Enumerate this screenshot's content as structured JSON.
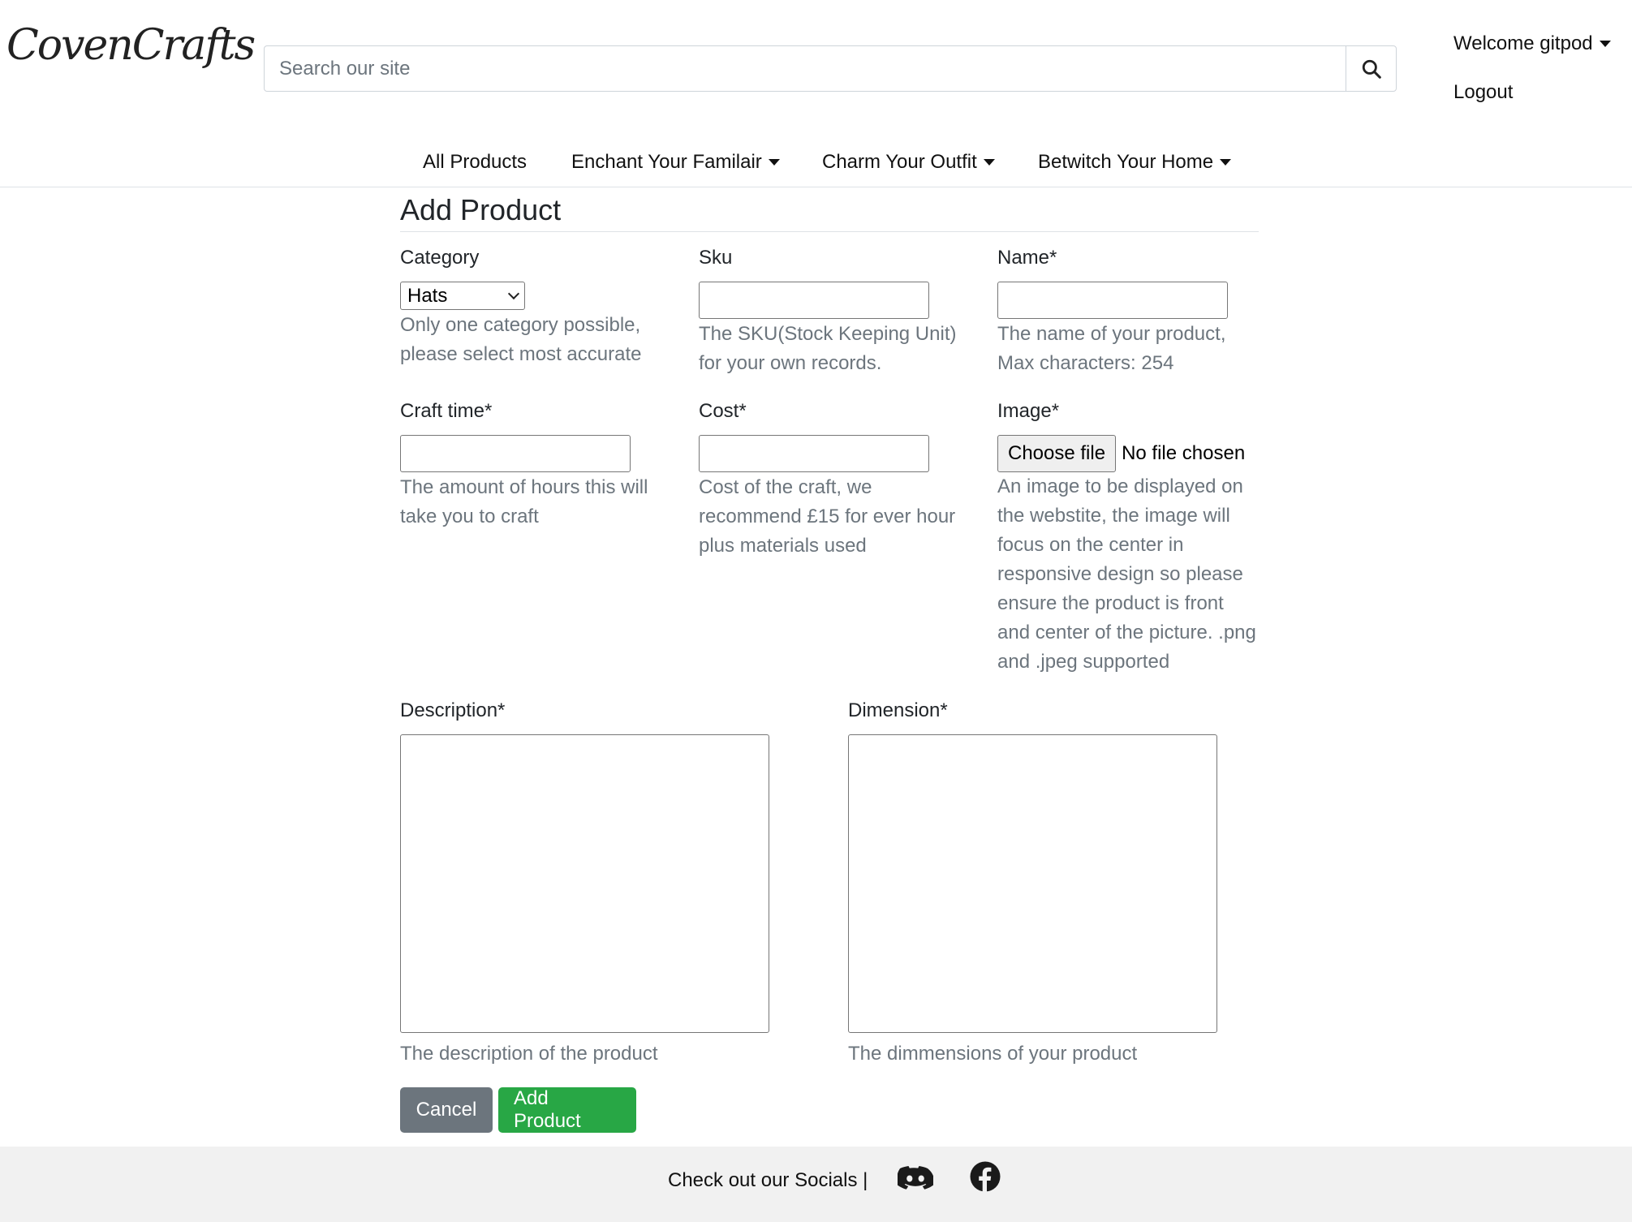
{
  "header": {
    "logo": "CovenCrafts",
    "search_placeholder": "Search our site",
    "account_label": "Welcome gitpod",
    "logout_label": "Logout"
  },
  "nav": {
    "items": [
      {
        "label": "All Products"
      },
      {
        "label": "Enchant Your Familair"
      },
      {
        "label": "Charm Your Outfit"
      },
      {
        "label": "Betwitch Your Home"
      }
    ]
  },
  "form": {
    "title": "Add Product",
    "category": {
      "label": "Category",
      "value": "Hats",
      "help": "Only one category possible, please select most accurate"
    },
    "sku": {
      "label": "Sku",
      "value": "",
      "help": "The SKU(Stock Keeping Unit) for your own records."
    },
    "name": {
      "label": "Name*",
      "value": "",
      "help": "The name of your product, Max characters: 254"
    },
    "craft_time": {
      "label": "Craft time*",
      "value": "",
      "help": "The amount of hours this will take you to craft"
    },
    "cost": {
      "label": "Cost*",
      "value": "",
      "help": "Cost of the craft, we recommend £15 for ever hour plus materials used"
    },
    "image": {
      "label": "Image*",
      "button": "Choose file",
      "status": "No file chosen",
      "help": "An image to be displayed on the webstite, the image will focus on the center in responsive design so please ensure the product is front and center of the picture. .png and .jpeg supported"
    },
    "description": {
      "label": "Description*",
      "value": "",
      "help": "The description of the product"
    },
    "dimension": {
      "label": "Dimension*",
      "value": "",
      "help": "The dimmensions of your product"
    },
    "cancel_label": "Cancel",
    "submit_label": "Add Product"
  },
  "footer": {
    "text": "Check out our Socials |",
    "socials": [
      {
        "icon": "discord-icon"
      },
      {
        "icon": "facebook-icon"
      }
    ]
  }
}
